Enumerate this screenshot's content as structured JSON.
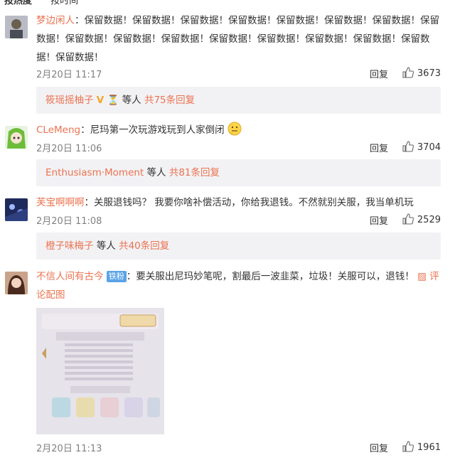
{
  "tabs": [
    "按热度",
    "按时间"
  ],
  "comments": [
    {
      "user": "梦边闲人",
      "text": "保留数据！保留数据！保留数据！保留数据！保留数据！保留数据！保留数据！保留数据！保留数据！保留数据！保留数据！保留数据！保留数据！保留数据！保留数据！保留数据！保留数据！",
      "time": "2月20日 11:17",
      "reply_label": "回复",
      "likes": "3673",
      "sub_user": "筱瑶摇柚子",
      "sub_mid": "等人",
      "sub_count": "共75条回复"
    },
    {
      "user": "CLeMeng",
      "text": "尼玛第一次玩游戏玩到人家倒闭",
      "time": "2月20日 11:06",
      "reply_label": "回复",
      "likes": "3704",
      "sub_user": "Enthusiasm·Moment",
      "sub_mid": "等人",
      "sub_count": "共81条回复"
    },
    {
      "user": "芙宝啊啊啊",
      "text": "关服退钱吗？ 我要你啥补偿活动，你给我退钱。不然就别关服，我当单机玩",
      "time": "2月20日 11:08",
      "reply_label": "回复",
      "likes": "2529",
      "sub_user": "橙子味梅子",
      "sub_mid": "等人",
      "sub_count": "共40条回复"
    },
    {
      "user": "不信人间有古今",
      "badge": "铁粉",
      "text": "要关服出尼玛妙笔呢，割最后一波韭菜，垃圾！关服可以，退钱！",
      "pic_icon": "▨",
      "pic_label": "评论配图",
      "time": "2月20日 11:13",
      "reply_label": "回复",
      "likes": "1961"
    }
  ],
  "colors": {
    "username": "#eb7350",
    "sub_bg": "#f2f2f5",
    "badge": "#5aa3e6"
  }
}
